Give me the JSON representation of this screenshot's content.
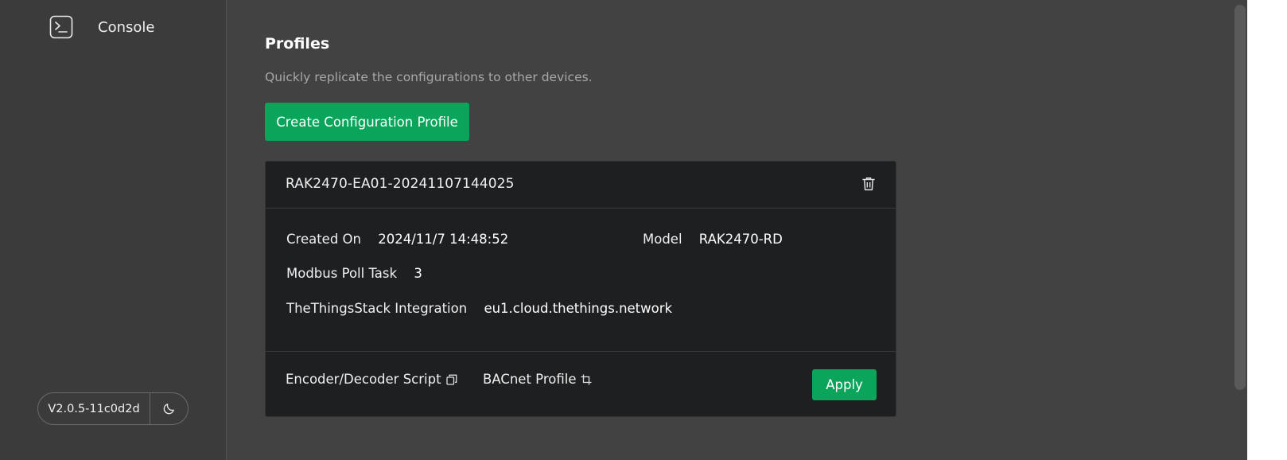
{
  "sidebar": {
    "nav": {
      "console_label": "Console",
      "console_icon": "terminal-icon"
    },
    "version": "V2.0.5-11c0d2d",
    "theme_icon": "moon-icon"
  },
  "profiles": {
    "title": "Profiles",
    "subtitle": "Quickly replicate the configurations to other devices.",
    "create_button": "Create Configuration Profile",
    "card": {
      "name": "RAK2470-EA01-20241107144025",
      "created_on_label": "Created On",
      "created_on_value": "2024/11/7 14:48:52",
      "model_label": "Model",
      "model_value": "RAK2470-RD",
      "modbus_label": "Modbus Poll Task",
      "modbus_value": "3",
      "integration_label": "TheThingsStack Integration",
      "integration_value": "eu1.cloud.thethings.network",
      "encoder_link": "Encoder/Decoder Script",
      "bacnet_link": "BACnet Profile",
      "apply_button": "Apply"
    }
  },
  "colors": {
    "accent_green": "#0aa55a",
    "page_bg": "#424242",
    "sidebar_bg": "#3b3b3b",
    "card_bg": "#1e1f21"
  }
}
